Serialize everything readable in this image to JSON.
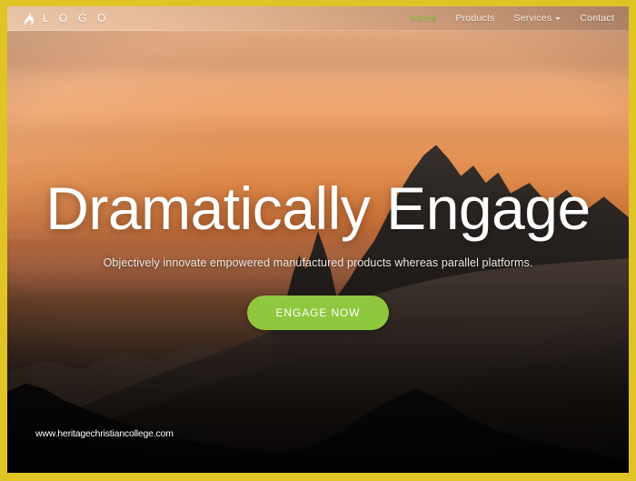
{
  "theme": {
    "frame_color": "#e0c425",
    "accent_green": "#8fc73e",
    "active_link_color": "#8fc640",
    "nav_text_color": "#f4efe9",
    "hero_text_color": "#ffffff"
  },
  "navbar": {
    "logo_icon": "flame-icon",
    "logo_text": "L O G O",
    "links": [
      {
        "label": "Home",
        "active": true,
        "has_dropdown": false
      },
      {
        "label": "Products",
        "active": false,
        "has_dropdown": false
      },
      {
        "label": "Services",
        "active": false,
        "has_dropdown": true
      },
      {
        "label": "Contact",
        "active": false,
        "has_dropdown": false
      }
    ],
    "dropdown_icon": "chevron-down-icon"
  },
  "hero": {
    "title": "Dramatically Engage",
    "subtitle": "Objectively innovate empowered manufactured products whereas parallel platforms.",
    "cta_label": "ENGAGE NOW",
    "background": "mountain-sunset-photo"
  },
  "watermark": {
    "text": "www.heritagechristiancollege.com"
  }
}
